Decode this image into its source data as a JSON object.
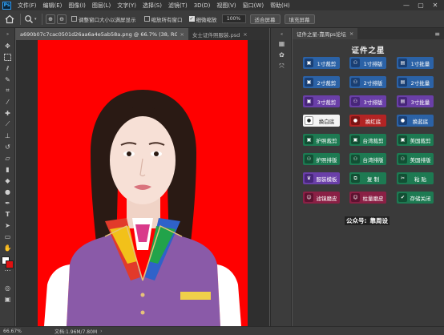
{
  "menubar": {
    "logo": "Ps",
    "items": [
      "文件(F)",
      "编辑(E)",
      "图像(I)",
      "图层(L)",
      "文字(Y)",
      "选择(S)",
      "滤镜(T)",
      "3D(D)",
      "视图(V)",
      "窗口(W)",
      "帮助(H)"
    ],
    "window_controls": [
      "—",
      "▢",
      "✕"
    ]
  },
  "options": {
    "checkbox_resize": "调整窗口大小以满屏显示",
    "checkbox_zoom_all": "缩放所有窗口",
    "checkbox_scrubby": "细微缩放",
    "zoom_value": "100%",
    "fit_button": "适合屏幕",
    "fill_button": "填充屏幕"
  },
  "tabs": [
    {
      "label": "a690b07c7cac0501d26aa6a4e5ab58a.png @ 66.7% (38, RGB/8) *"
    },
    {
      "label": "女士证件照服装.psd"
    }
  ],
  "status": {
    "zoom": "66.67%",
    "doc": "文档:1.96M/7.80M"
  },
  "panel": {
    "tab_label": "证件之星-靠周ps论坛",
    "title": "证件之星",
    "footer_prefix": "公众号:",
    "footer_name": "靠周设",
    "buttons": [
      {
        "label": "1寸裁剪",
        "icon": "crop-icon"
      },
      {
        "label": "1寸排版",
        "icon": "layout-icon"
      },
      {
        "label": "1寸批量",
        "icon": "batch-icon"
      },
      {
        "label": "2寸裁剪",
        "icon": "crop-icon"
      },
      {
        "label": "2寸排版",
        "icon": "layout-icon"
      },
      {
        "label": "2寸批量",
        "icon": "batch-icon"
      },
      {
        "label": "3寸裁剪",
        "icon": "crop-icon"
      },
      {
        "label": "3寸排版",
        "icon": "layout-icon"
      },
      {
        "label": "3寸批量",
        "icon": "batch-icon"
      },
      {
        "label": "换白底",
        "icon": "white-bg-icon"
      },
      {
        "label": "换红底",
        "icon": "red-bg-icon"
      },
      {
        "label": "换蓝底",
        "icon": "blue-bg-icon"
      },
      {
        "label": "护照裁剪",
        "icon": "crop-icon"
      },
      {
        "label": "台湾裁剪",
        "icon": "crop-icon"
      },
      {
        "label": "美国裁剪",
        "icon": "crop-icon"
      },
      {
        "label": "护照排版",
        "icon": "layout-icon"
      },
      {
        "label": "台湾排版",
        "icon": "layout-icon"
      },
      {
        "label": "美国排版",
        "icon": "layout-icon"
      },
      {
        "label": "服装模板",
        "icon": "clothes-icon"
      },
      {
        "label": "复 制",
        "icon": "copy-icon"
      },
      {
        "label": "粘 贴",
        "icon": "paste-icon"
      },
      {
        "label": "滤镜磨皮",
        "icon": "filter-icon"
      },
      {
        "label": "柱量磨皮",
        "icon": "retouch-icon"
      },
      {
        "label": "存储关闭",
        "icon": "save-close-icon"
      }
    ]
  },
  "badge": {
    "text": "★"
  },
  "colors": {
    "photo_bg": "#ff0000",
    "button_blue": "#2b62a6",
    "button_purple": "#6a3fa8",
    "button_green": "#1d7a52"
  }
}
